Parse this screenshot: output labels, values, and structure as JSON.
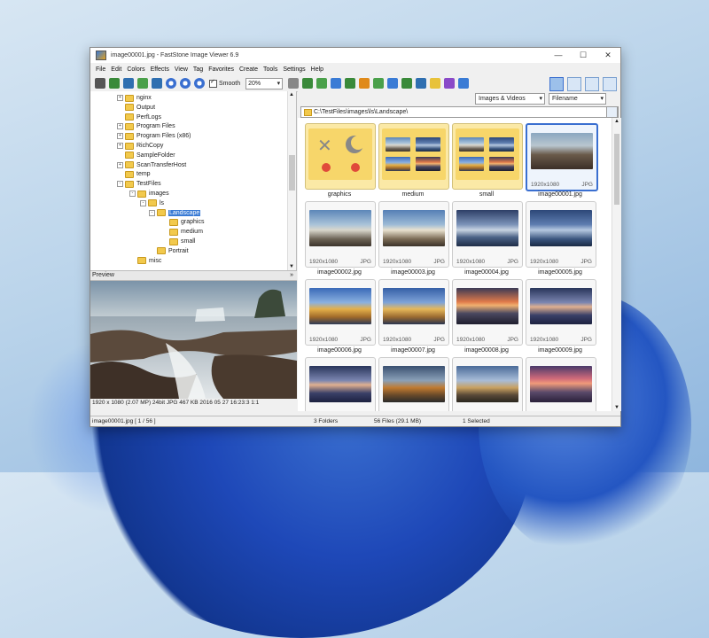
{
  "window": {
    "title": "image00001.jpg  -  FastStone Image Viewer 6.9",
    "controls": [
      "—",
      "☐",
      "✕"
    ]
  },
  "menu": [
    "File",
    "Edit",
    "Colors",
    "Effects",
    "View",
    "Tag",
    "Favorites",
    "Create",
    "Tools",
    "Settings",
    "Help"
  ],
  "toolbar": {
    "smooth_label": "Smooth",
    "zoom_value": "20%"
  },
  "tree": {
    "items": [
      {
        "label": "nginx",
        "depth": 1,
        "expander": "+"
      },
      {
        "label": "Output",
        "depth": 1,
        "expander": ""
      },
      {
        "label": "PerfLogs",
        "depth": 1,
        "expander": ""
      },
      {
        "label": "Program Files",
        "depth": 1,
        "expander": "+"
      },
      {
        "label": "Program Files (x86)",
        "depth": 1,
        "expander": "+"
      },
      {
        "label": "RichCopy",
        "depth": 1,
        "expander": "+"
      },
      {
        "label": "SampleFolder",
        "depth": 1,
        "expander": ""
      },
      {
        "label": "ScanTransferHost",
        "depth": 1,
        "expander": "+"
      },
      {
        "label": "temp",
        "depth": 1,
        "expander": ""
      },
      {
        "label": "TestFiles",
        "depth": 1,
        "expander": "-"
      },
      {
        "label": "images",
        "depth": 2,
        "expander": "-"
      },
      {
        "label": "ls",
        "depth": 3,
        "expander": "-"
      },
      {
        "label": "Landscape",
        "depth": 4,
        "expander": "-"
      },
      {
        "label": "graphics",
        "depth": 5,
        "expander": ""
      },
      {
        "label": "medium",
        "depth": 5,
        "expander": ""
      },
      {
        "label": "small",
        "depth": 5,
        "expander": ""
      },
      {
        "label": "Portrait",
        "depth": 4,
        "expander": ""
      },
      {
        "label": "misc",
        "depth": 2,
        "expander": ""
      }
    ],
    "selected": "Landscape"
  },
  "preview": {
    "header": "Preview",
    "collapse_glyph": "»",
    "info": "1920 x 1080 (2.07 MP)  24bit  JPG  467 KB  2016 05 27 16:23:3 1:1"
  },
  "browser": {
    "filter": "Images & Videos",
    "sort": "Filename",
    "path": "C:\\TestFiles\\images\\ls\\Landscape\\",
    "folders": [
      "graphics",
      "medium",
      "small"
    ],
    "images": [
      {
        "name": "image00001.jpg",
        "res": "1920x1080",
        "type": "JPG",
        "selected": true
      },
      {
        "name": "image00002.jpg",
        "res": "1920x1080",
        "type": "JPG",
        "selected": false
      },
      {
        "name": "image00003.jpg",
        "res": "1920x1080",
        "type": "JPG",
        "selected": false
      },
      {
        "name": "image00004.jpg",
        "res": "1920x1080",
        "type": "JPG",
        "selected": false
      },
      {
        "name": "image00005.jpg",
        "res": "1920x1080",
        "type": "JPG",
        "selected": false
      },
      {
        "name": "image00006.jpg",
        "res": "1920x1080",
        "type": "JPG",
        "selected": false
      },
      {
        "name": "image00007.jpg",
        "res": "1920x1080",
        "type": "JPG",
        "selected": false
      },
      {
        "name": "image00008.jpg",
        "res": "1920x1080",
        "type": "JPG",
        "selected": false
      },
      {
        "name": "image00009.jpg",
        "res": "1920x1080",
        "type": "JPG",
        "selected": false
      }
    ]
  },
  "status": {
    "file": "image00001.jpg [ 1 / 56 ]",
    "folders": "3 Folders",
    "files": "56 Files (29.1 MB)",
    "selected": "1 Selected"
  },
  "colors": {
    "accent": "#3a6fd0",
    "selection": "#3a7bd5",
    "folder": "#f2c94c"
  }
}
